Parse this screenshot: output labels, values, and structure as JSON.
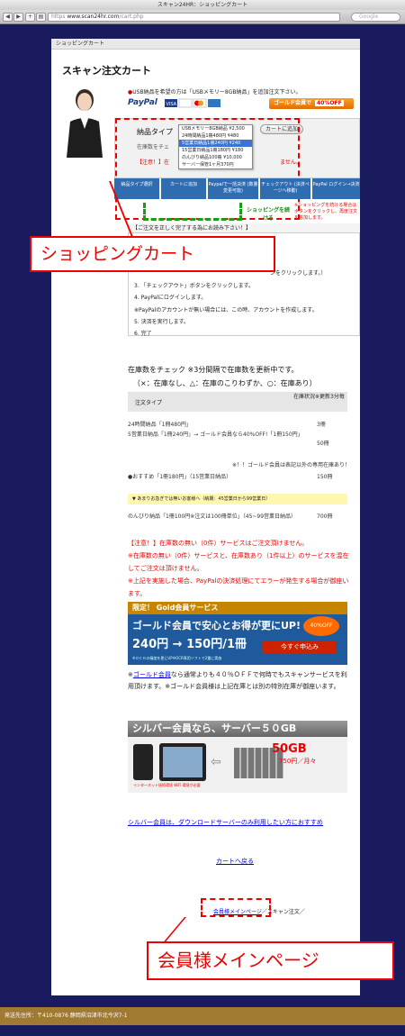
{
  "browser": {
    "title": "スキャン24HR：ショッピングカート",
    "url_lock": "https",
    "url_host": "www.scan24hr.com",
    "url_path": "/cart.php",
    "search_placeholder": "Google"
  },
  "breadcrumb": "ショッピングカート",
  "page_title": "スキャン注文カート",
  "usb_note": "USB納品を希望の方は「USBメモリー8GB納品」を追加注文下さい。",
  "paypal_label": "PayPal",
  "cards_label": "VISA",
  "gold_button": {
    "label": "ゴールド会員で",
    "off": "40%OFF"
  },
  "order": {
    "type_label": "納品タイプ",
    "stock_label": "在庫数をチェ",
    "warn_prefix": "【注意！】在",
    "warn_suffix": "ません。",
    "add_to_cart": "カートに追加"
  },
  "dropdown_options": [
    {
      "label": "USBメモリー8GB納品 ¥2,500",
      "selected": false
    },
    {
      "label": "24時間納品1冊480円 ¥480",
      "selected": false
    },
    {
      "label": "5営業日納品1冊240円 ¥240",
      "selected": true
    },
    {
      "label": "15営業日納品1冊180円 ¥180",
      "selected": false
    },
    {
      "label": "のんびり納品100冊 ¥10,000",
      "selected": false
    },
    {
      "label": "サーバー保管1ヶ月370円",
      "selected": false
    }
  ],
  "steps": [
    "納品タイプ選択",
    "カートに追加",
    "Paypalで一括決済 (数量変更可能)",
    "チェックアウト (決済ページへ移動)",
    "PayPal ログイン→決済"
  ],
  "continue_label": "ショッピングを続ける",
  "continue_note": "※ショッピングを続ける場合はボタンをクリックし、再度注文を追加します。",
  "instructions": {
    "header": "【ご注文を正しく完了する為にお読み下さい！】",
    "items": [
      "ンをクリックします。）",
      "3. 「チェックアウト」ボタンをクリックします。",
      "4. PayPalにログインします。",
      "※PayPalのアカウントが無い場合には、この時、アカウントを作成します。",
      "5. 決済を実行します。",
      "6. 完了"
    ]
  },
  "callout1": "ショッピングカート",
  "stock": {
    "heading": "在庫数をチェック ※3分間隔で在庫数を更新中です。",
    "legend": "（×：在庫なし、△：在庫のこりわずか、○：在庫あり）",
    "col_type": "注文タイプ",
    "col_qty": "在庫状況※更新3分毎",
    "rows": [
      {
        "type": "24時間納品「1冊480円」",
        "qty": "3冊"
      },
      {
        "type": "5営業日納品「1冊240円」→ ゴールド会員なら40%OFF!「1冊150円」",
        "qty": "50冊"
      },
      {
        "type": "※！！ゴールド会員は表記以外の専用在庫あり！",
        "qty": ""
      },
      {
        "type": "●おすすめ「1冊180円」（15営業日納品）",
        "qty": "150冊"
      }
    ],
    "slow_header": "▼ あまりお急ぎでは無いお客様へ（納期：45営業日から99営業日）",
    "slow_row": {
      "type": "のんびり納品「1冊100円※注文は100冊単位」（45~99営業日納品）",
      "qty": "700冊"
    }
  },
  "warnings": [
    "【注意！】在庫数の無い（0件）サービスはご注文頂けません。",
    "※在庫数の無い（0件）サービスと、在庫数あり（1件以上）のサービスを混在してご注文は頂けません。",
    "※上記を実施した場合、PayPalの決済処理にてエラーが発生する場合が御座います。"
  ],
  "gold_banner": {
    "top": "限定！ Gold会員サービス",
    "line1": "ゴールド会員で安心とお得が更にUP!",
    "line2": "240円 → 150円/1冊",
    "cta": "今すぐ申込み",
    "badge": "40%OFF",
    "small": "※ＯＣＲの精度を更にUP※OCR専用ソフトで2重に実施"
  },
  "gold_text_link": "ゴールド会員",
  "gold_text": "なら通常よりも４０％ＯＦＦで何時でもスキャンサービスを利用頂けます。※ゴールド会員様は上記在庫とは別の特別在庫が御座います。",
  "silver_banner": {
    "top": "シルバー会員なら、サーバー５０GB",
    "gb": "50GB",
    "gb_sub": "750円／月々",
    "note": "インターネット接続環境 WiFi 環境が必要"
  },
  "silver_link": "シルバー会員は、ダウンロードサーバーのみ利用したい方におすすめ",
  "back_link": "カートへ戻る",
  "footer_bc_link": "会員様メインページ",
  "footer_bc_rest": "／スキャン注文／",
  "callout2": "会員様メインページ",
  "bottom_bar": "発送先住所：〒410-0876 静岡県沼津市北今沢7-1"
}
